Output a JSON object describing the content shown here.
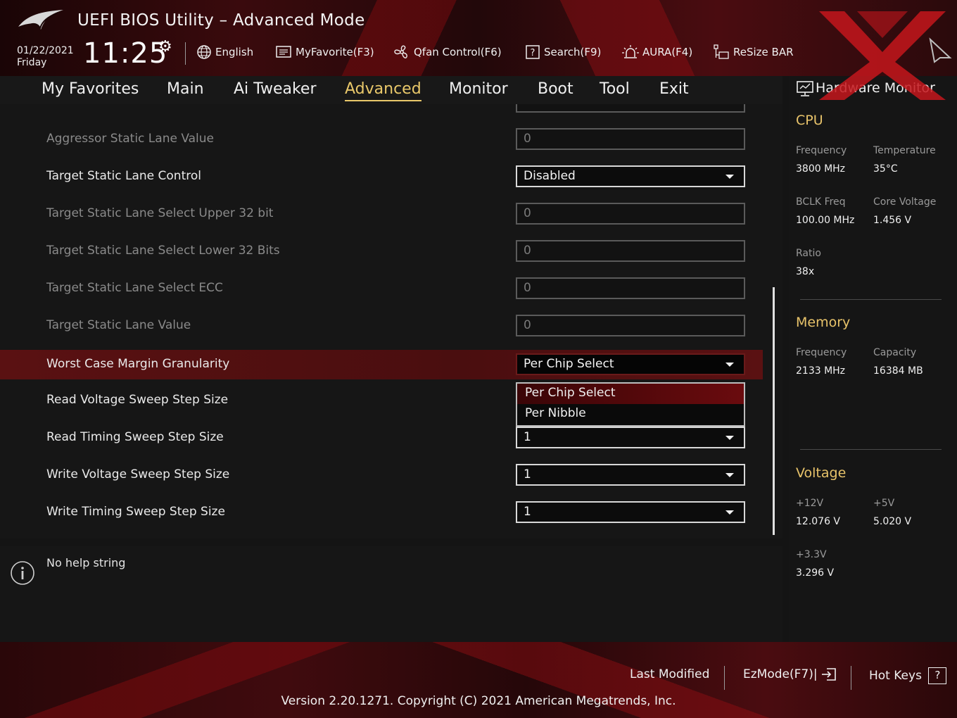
{
  "header": {
    "title": "UEFI BIOS Utility – Advanced Mode",
    "date": "01/22/2021",
    "day": "Friday",
    "time": "11:25",
    "toolbar": {
      "language": "English",
      "my_favorite": "MyFavorite(F3)",
      "qfan": "Qfan Control(F6)",
      "search": "Search(F9)",
      "aura": "AURA(F4)",
      "resize_bar": "ReSize BAR"
    }
  },
  "menu": {
    "tabs": [
      "My Favorites",
      "Main",
      "Ai Tweaker",
      "Advanced",
      "Monitor",
      "Boot",
      "Tool",
      "Exit"
    ],
    "active": "Advanced"
  },
  "settings": [
    {
      "label": "Aggressor Static Lane Value",
      "value": "0",
      "kind": "field"
    },
    {
      "label": "Target Static Lane Control",
      "value": "Disabled",
      "kind": "dropdown"
    },
    {
      "label": "Target Static Lane Select Upper 32 bit",
      "value": "0",
      "kind": "field"
    },
    {
      "label": "Target Static Lane Select Lower 32 Bits",
      "value": "0",
      "kind": "field"
    },
    {
      "label": "Target Static Lane Select ECC",
      "value": "0",
      "kind": "field"
    },
    {
      "label": "Target Static Lane Value",
      "value": "0",
      "kind": "field"
    },
    {
      "label": "Worst Case Margin Granularity",
      "value": "Per Chip Select",
      "kind": "dropdown"
    },
    {
      "label": "Read Voltage Sweep Step Size",
      "value": "",
      "kind": "none"
    },
    {
      "label": "Read Timing Sweep Step Size",
      "value": "1",
      "kind": "dropdown"
    },
    {
      "label": "Write Voltage Sweep Step Size",
      "value": "1",
      "kind": "dropdown"
    },
    {
      "label": "Write Timing Sweep Step Size",
      "value": "1",
      "kind": "dropdown"
    }
  ],
  "open_dropdown": {
    "options": [
      "Per Chip Select",
      "Per Nibble"
    ],
    "highlighted": "Per Chip Select"
  },
  "help": {
    "text": "No help string"
  },
  "hardware_monitor": {
    "title": "Hardware Monitor",
    "cpu": {
      "heading": "CPU",
      "frequency_label": "Frequency",
      "frequency": "3800 MHz",
      "temperature_label": "Temperature",
      "temperature": "35°C",
      "bclk_label": "BCLK Freq",
      "bclk": "100.00 MHz",
      "core_voltage_label": "Core Voltage",
      "core_voltage": "1.456 V",
      "ratio_label": "Ratio",
      "ratio": "38x"
    },
    "memory": {
      "heading": "Memory",
      "frequency_label": "Frequency",
      "frequency": "2133 MHz",
      "capacity_label": "Capacity",
      "capacity": "16384 MB"
    },
    "voltage": {
      "heading": "Voltage",
      "v12_label": "+12V",
      "v12": "12.076 V",
      "v5_label": "+5V",
      "v5": "5.020 V",
      "v33_label": "+3.3V",
      "v33": "3.296 V"
    }
  },
  "footer": {
    "last_modified": "Last Modified",
    "ezmode": "EzMode(F7)|",
    "hot_keys": "Hot Keys",
    "hot_keys_glyph": "?",
    "version": "Version 2.20.1271. Copyright (C) 2021 American Megatrends, Inc."
  },
  "colors": {
    "accent": "#e9c86a",
    "selection": "#5a1112",
    "header_red": "#4a0c10"
  },
  "icons": [
    "rog-logo-icon",
    "gear-icon",
    "globe-icon",
    "favorite-list-icon",
    "fan-icon",
    "search-help-icon",
    "aura-light-icon",
    "resize-bar-icon",
    "cursor-icon",
    "monitor-icon",
    "info-icon",
    "ezmode-exit-icon",
    "question-icon"
  ]
}
